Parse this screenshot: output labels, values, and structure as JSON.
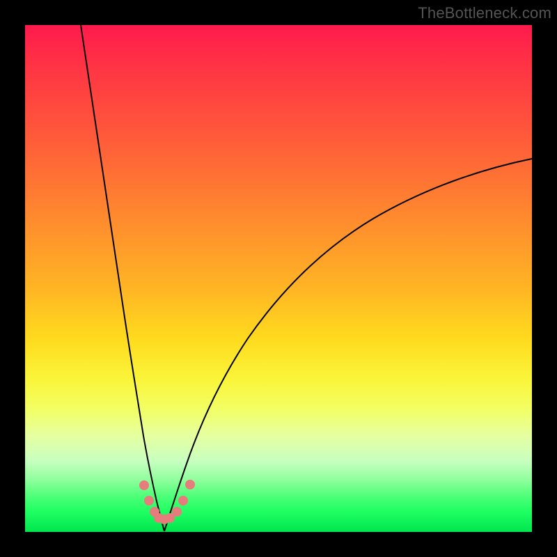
{
  "watermark": "TheBottleneck.com",
  "colors": {
    "frame": "#000000",
    "curve": "#000000",
    "marker": "#e77c7c"
  },
  "chart_data": {
    "type": "line",
    "title": "",
    "xlabel": "",
    "ylabel": "",
    "xlim": [
      0,
      100
    ],
    "ylim": [
      0,
      100
    ],
    "grid": false,
    "note": "Axes are unlabeled in the image. Values are estimated from pixel positions; y is read as 100 at the top edge down to 0 at the bottom edge.",
    "series": [
      {
        "name": "left-branch",
        "x": [
          11.0,
          14.3,
          17.0,
          19.2,
          21.0,
          22.6,
          23.8,
          25.0,
          25.8,
          26.4,
          27.5
        ],
        "y": [
          100.0,
          70.0,
          48.0,
          33.0,
          22.0,
          14.0,
          9.0,
          6.0,
          4.0,
          2.7,
          0.0
        ]
      },
      {
        "name": "right-branch",
        "x": [
          27.5,
          29.5,
          31.5,
          33.8,
          37.0,
          41.0,
          47.0,
          54.0,
          62.0,
          71.0,
          81.0,
          91.0,
          100.0
        ],
        "y": [
          0.0,
          3.0,
          7.0,
          12.0,
          19.0,
          27.0,
          37.0,
          46.0,
          53.5,
          60.0,
          65.5,
          70.0,
          73.5
        ]
      }
    ],
    "markers": [
      {
        "x": 23.5,
        "y": 9.2
      },
      {
        "x": 24.4,
        "y": 6.2
      },
      {
        "x": 25.5,
        "y": 4.0
      },
      {
        "x": 26.4,
        "y": 2.7
      },
      {
        "x": 27.5,
        "y": 2.5
      },
      {
        "x": 28.6,
        "y": 2.7
      },
      {
        "x": 29.9,
        "y": 4.0
      },
      {
        "x": 31.2,
        "y": 6.2
      },
      {
        "x": 32.6,
        "y": 9.4
      }
    ]
  }
}
